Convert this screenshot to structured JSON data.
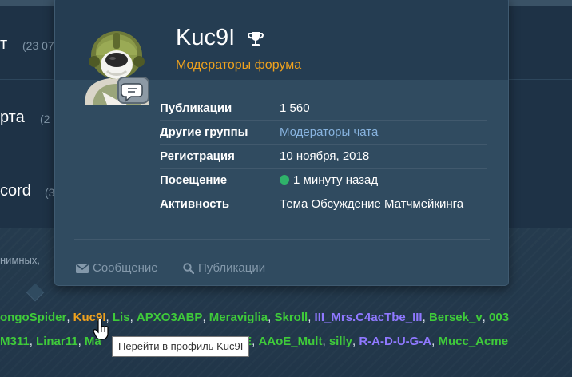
{
  "background": {
    "forums": [
      {
        "name": "т",
        "count": "(23 07"
      },
      {
        "name": "рта",
        "count": "(2"
      },
      {
        "name": "cord",
        "count": "(3"
      }
    ],
    "anon_text": "нимных,",
    "online_row1": [
      {
        "name": "ongoSpider",
        "color": "green"
      },
      {
        "name": "Kuc9I",
        "color": "orange"
      },
      {
        "name": "Lis",
        "color": "green"
      },
      {
        "name": "APXO3ABP",
        "color": "green"
      },
      {
        "name": "Meraviglia",
        "color": "green"
      },
      {
        "name": "Skroll",
        "color": "green"
      },
      {
        "name": "III_Mrs.C4acTbe_III",
        "color": "purple"
      },
      {
        "name": "Bersek_v",
        "color": "green"
      },
      {
        "name": "003",
        "color": "green"
      }
    ],
    "online_row2": [
      {
        "name": "M311",
        "color": "green"
      },
      {
        "name": "Linar11",
        "color": "green"
      },
      {
        "name": "Ma",
        "color": "green"
      },
      {
        "name": "SE",
        "color": "green"
      },
      {
        "name": "AAoE_Mult",
        "color": "green"
      },
      {
        "name": "silly",
        "color": "green"
      },
      {
        "name": "R-A-D-U-G-A",
        "color": "purple"
      },
      {
        "name": "Mucc_Acme",
        "color": "green"
      }
    ]
  },
  "popup": {
    "username": "Kuc9I",
    "group": "Модераторы форума",
    "avatar_icon": "soldier-avatar-icon",
    "badge_icon": "chat-moderator-badge-icon",
    "trophy_icon": "trophy-icon",
    "info": [
      {
        "label": "Публикации",
        "value": "1 560",
        "link": false
      },
      {
        "label": "Другие группы",
        "value": "Модераторы чата",
        "link": true
      },
      {
        "label": "Регистрация",
        "value": "10 ноября, 2018",
        "link": false
      },
      {
        "label": "Посещение",
        "value": "1 минуту назад",
        "link": false,
        "online": true
      },
      {
        "label": "Активность",
        "value": "Тема Обсуждение Матчмейкинга",
        "link": false
      }
    ],
    "actions": {
      "message": "Сообщение",
      "message_icon": "envelope-icon",
      "posts": "Публикации",
      "posts_icon": "search-icon"
    }
  },
  "tooltip": "Перейти в профиль Kuc9I",
  "colors": {
    "group_moderator": "#f0a21d",
    "link": "#88b4e0",
    "online_green": "#3fcb3a",
    "online_purple": "#8f78ff"
  }
}
